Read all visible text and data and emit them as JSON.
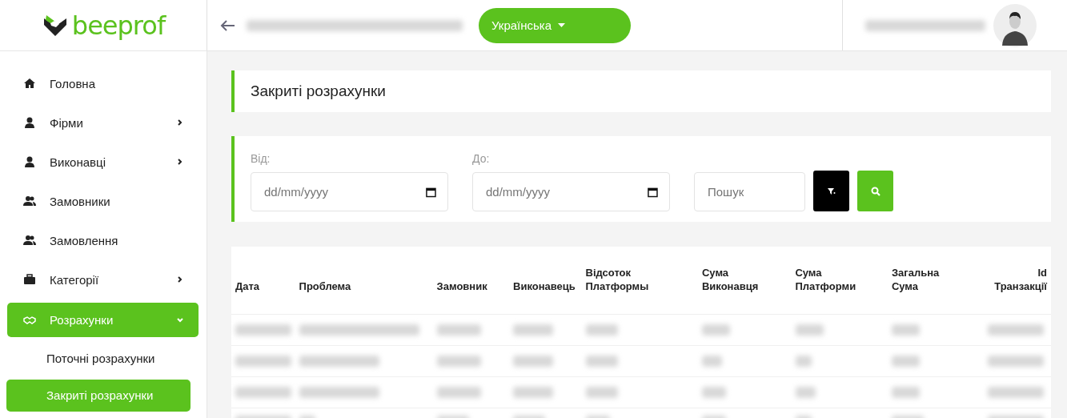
{
  "header": {
    "logo": "beeprof",
    "language": "Українська"
  },
  "sidebar": {
    "items": [
      {
        "label": "Головна",
        "kind": "link",
        "selected": false
      },
      {
        "label": "Фірми",
        "kind": "group",
        "selected": false,
        "expanded": false
      },
      {
        "label": "Виконавці",
        "kind": "group",
        "selected": false,
        "expanded": false
      },
      {
        "label": "Замовники",
        "kind": "link",
        "selected": false
      },
      {
        "label": "Замовлення",
        "kind": "link",
        "selected": false
      },
      {
        "label": "Категорії",
        "kind": "group",
        "selected": false,
        "expanded": false
      },
      {
        "label": "Розрахунки",
        "kind": "group",
        "selected": true,
        "expanded": true,
        "children": [
          {
            "label": "Поточні розрахунки",
            "selected": false
          },
          {
            "label": "Закриті розрахунки",
            "selected": true
          }
        ]
      }
    ]
  },
  "page_title": "Закриті розрахунки",
  "filters": {
    "date_from": {
      "label": "Від:",
      "placeholder": "dd/mm/yyyy"
    },
    "date_to": {
      "label": "До:",
      "placeholder": "dd/mm/yyyy"
    },
    "search": {
      "placeholder": "Пошук"
    }
  },
  "table": {
    "columns": [
      "Дата",
      "Проблема",
      "Замовник",
      "Виконавець",
      "Відсоток Платформы",
      "Сума Виконавця",
      "Сума Платформи",
      "Загальна Сума",
      "Id Транзакції"
    ],
    "rows": [
      {
        "kind": "redacted"
      },
      {
        "kind": "redacted"
      },
      {
        "kind": "redacted"
      },
      {
        "kind": "redacted"
      }
    ]
  }
}
